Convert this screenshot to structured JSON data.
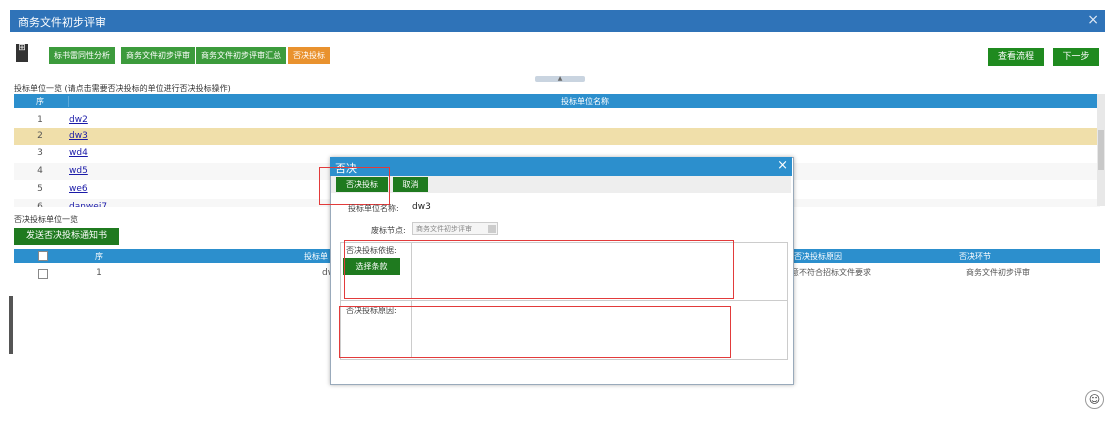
{
  "window": {
    "title": "商务文件初步评审",
    "close": "×"
  },
  "toolbar": {
    "grid_glyph": "⊞",
    "tabs": [
      {
        "label": "标书雷同性分析"
      },
      {
        "label": "商务文件初步评审"
      },
      {
        "label": "商务文件初步评审汇总"
      },
      {
        "label": "否决投标"
      }
    ],
    "view_flow_label": "查看流程",
    "next_label": "下一步",
    "collapse_glyph": "▲"
  },
  "bidder_list": {
    "title": "投标单位一览 (请点击需要否决投标的单位进行否决投标操作)",
    "columns": [
      "序",
      "投标单位名称"
    ],
    "rows": [
      {
        "no": "1",
        "name": "dw2"
      },
      {
        "no": "2",
        "name": "dw3"
      },
      {
        "no": "3",
        "name": "wd4"
      },
      {
        "no": "4",
        "name": "wd5"
      },
      {
        "no": "5",
        "name": "we6"
      },
      {
        "no": "6",
        "name": "danwei7"
      }
    ],
    "selected_index": 1
  },
  "rejected_list": {
    "title": "否决投标单位一览",
    "send_button": "发送否决投标通知书",
    "columns": [
      "序",
      "投标单",
      "否决投标原因",
      "否决环节"
    ],
    "rows": [
      {
        "no": "1",
        "unit": "dw",
        "reason": "意不符合招标文件要求",
        "stage": "商务文件初步评审"
      }
    ]
  },
  "dialog": {
    "title": "否决",
    "close": "×",
    "reject_button": "否决投标",
    "cancel_button": "取消",
    "unit_label": "投标单位名称:",
    "unit_value": "dw3",
    "node_label": "废标节点:",
    "node_value": "商务文件初步评审",
    "basis_label": "否决投标依据:",
    "choose_clause_button": "选择条款",
    "reason_label": "否决投标原因:"
  },
  "colors": {
    "title_bar": "#2f73b8",
    "header_blue": "#2c8fcd",
    "green": "#3c9b3c",
    "orange_tab": "#e9922e",
    "selected_row": "#f0dfaa",
    "highlight_red": "#e23b3b"
  }
}
